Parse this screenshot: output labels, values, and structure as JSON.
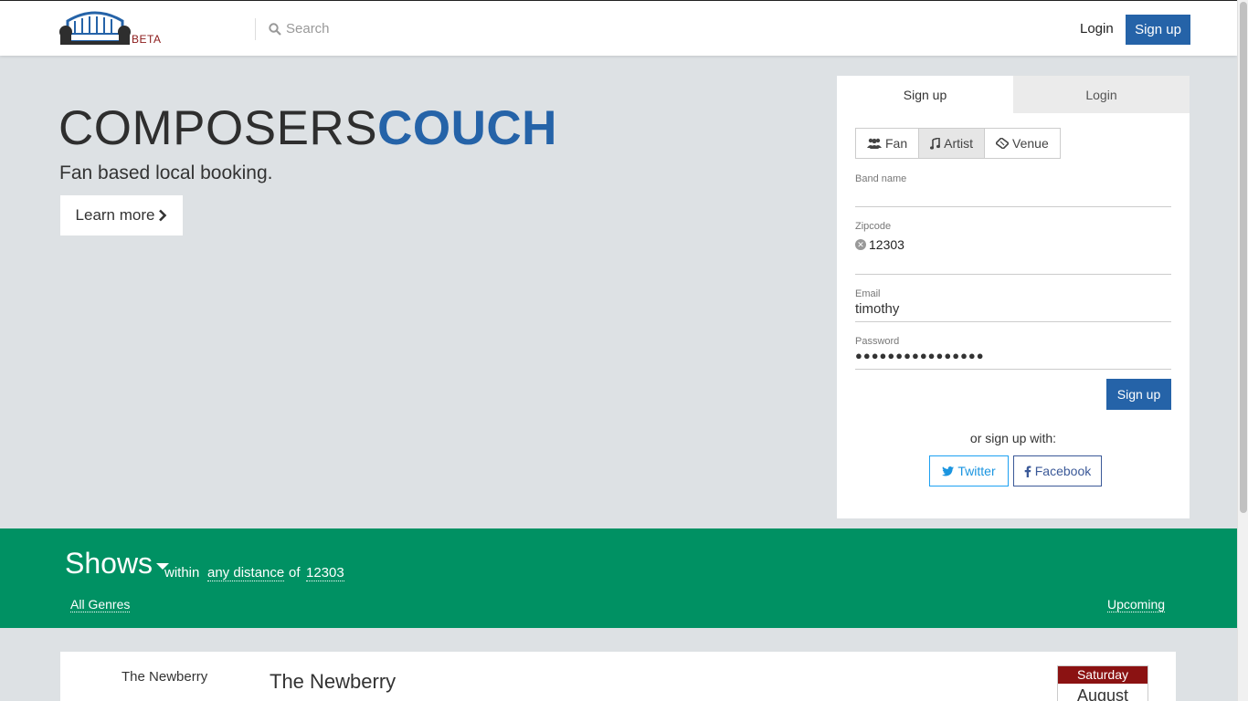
{
  "navbar": {
    "beta_label": "BETA",
    "search_placeholder": "Search",
    "login_label": "Login",
    "signup_label": "Sign up"
  },
  "hero": {
    "title_part1": "COMPOSERS",
    "title_part2": "COUCH",
    "tagline": "Fan based local booking.",
    "learn_more_label": "Learn more"
  },
  "signup_panel": {
    "tabs": [
      {
        "label": "Sign up",
        "active": true
      },
      {
        "label": "Login",
        "active": false
      }
    ],
    "roles": [
      {
        "label": "Fan",
        "icon": "users-icon",
        "active": false
      },
      {
        "label": "Artist",
        "icon": "music-icon",
        "active": true
      },
      {
        "label": "Venue",
        "icon": "ticket-icon",
        "active": false
      }
    ],
    "fields": {
      "band_name": {
        "label": "Band name",
        "value": ""
      },
      "zipcode": {
        "label": "Zipcode",
        "value": "12303"
      },
      "email": {
        "label": "Email",
        "value": "timothy"
      },
      "password": {
        "label": "Password",
        "value": "●●●●●●●●●●●●●●●●"
      }
    },
    "submit_label": "Sign up",
    "or_text": "or sign up with:",
    "social": {
      "twitter_label": "Twitter",
      "facebook_label": "Facebook"
    }
  },
  "shows": {
    "title": "Shows",
    "within_text": "within",
    "distance_value": "any distance",
    "of_text": "of",
    "zip_value": "12303",
    "genres_label": "All Genres",
    "upcoming_label": "Upcoming"
  },
  "show_card": {
    "venue_small": "The Newberry",
    "venue_title": "The Newberry",
    "day": "Saturday",
    "month": "August"
  },
  "colors": {
    "brand_blue": "#2563a8",
    "green_band": "#009163",
    "beta_red": "#8b1a1a",
    "calendar_red": "#8b1212",
    "background": "#dde1e4"
  }
}
